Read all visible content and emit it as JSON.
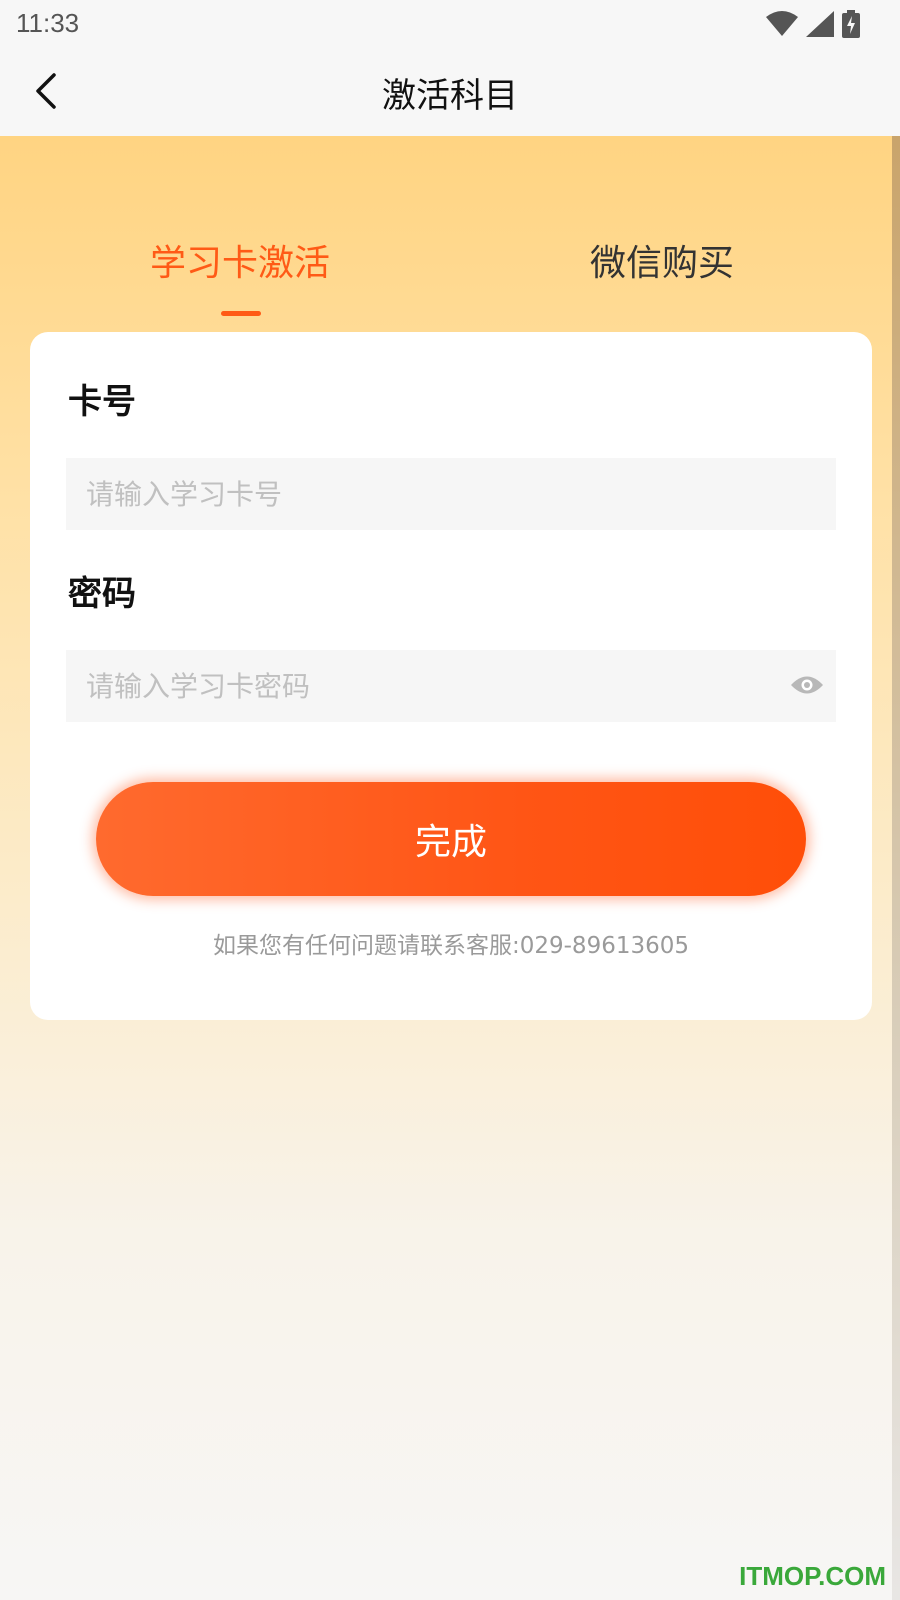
{
  "status_bar": {
    "time": "11:33"
  },
  "nav": {
    "title": "激活科目"
  },
  "tabs": [
    {
      "label": "学习卡激活",
      "active": true
    },
    {
      "label": "微信购买",
      "active": false
    }
  ],
  "form": {
    "card_label": "卡号",
    "card_placeholder": "请输入学习卡号",
    "card_value": "",
    "password_label": "密码",
    "password_placeholder": "请输入学习卡密码",
    "password_value": "",
    "submit_label": "完成",
    "help_text": "如果您有任何问题请联系客服:029-89613605"
  },
  "watermark": "ITMOP.COM",
  "colors": {
    "accent": "#ff5a16",
    "watermark": "#3aa83a"
  },
  "icons": {
    "back": "chevron-left-icon",
    "password_toggle": "eye-icon",
    "wifi": "wifi-icon",
    "signal": "signal-icon",
    "battery": "battery-icon"
  }
}
